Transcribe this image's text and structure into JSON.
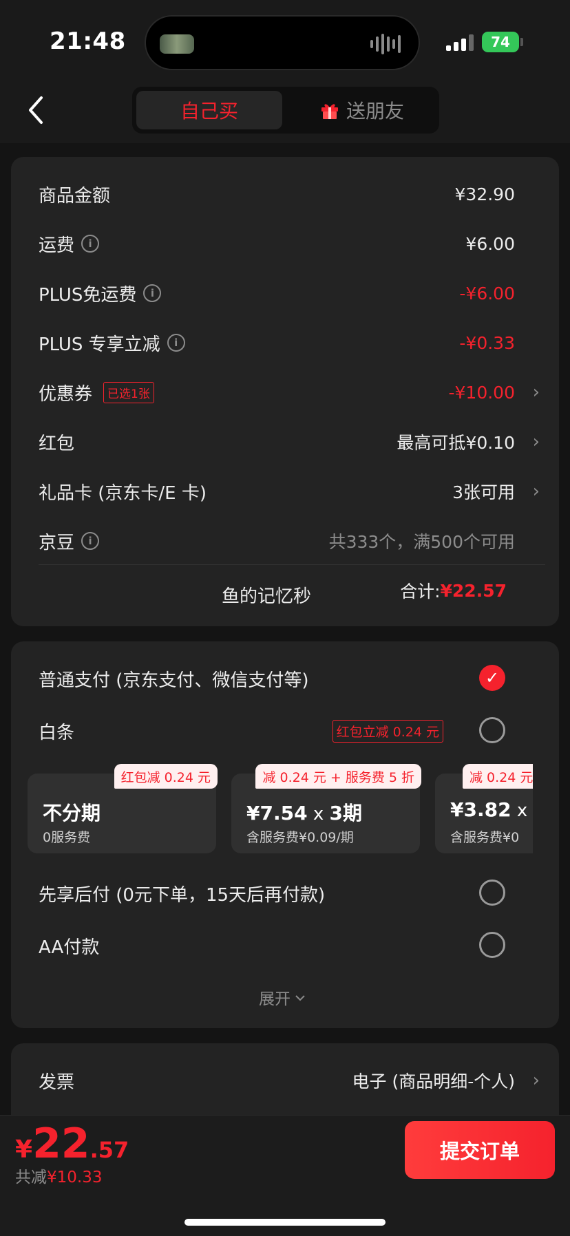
{
  "status": {
    "time": "21:48",
    "battery": "74"
  },
  "nav": {
    "tab_self": "自己买",
    "tab_gift": "送朋友"
  },
  "summary": {
    "goods_label": "商品金额",
    "goods_value": "¥32.90",
    "shipping_label": "运费",
    "shipping_value": "¥6.00",
    "plus_free_label": "PLUS免运费",
    "plus_free_value": "-¥6.00",
    "plus_cut_label": "PLUS 专享立减",
    "plus_cut_value": "-¥0.33",
    "coupon_label": "优惠券",
    "coupon_tag": "已选1张",
    "coupon_value": "-¥10.00",
    "redpack_label": "红包",
    "redpack_value": "最高可抵¥0.10",
    "giftcard_label": "礼品卡 (京东卡/E 卡)",
    "giftcard_value": "3张可用",
    "beans_label": "京豆",
    "beans_value": "共333个，满500个可用",
    "shop_name": "鱼的记忆秒",
    "total_label": "合计:",
    "total_value": "¥22.57"
  },
  "payment": {
    "normal_label": "普通支付 (京东支付、微信支付等)",
    "baitiao_label": "白条",
    "baitiao_tag": "红包立减 0.24 元",
    "plans": [
      {
        "badge": "红包减 0.24 元",
        "main": "不分期",
        "x": "",
        "periods": "",
        "sub": "0服务费"
      },
      {
        "badge": "减 0.24 元 + 服务费 5 折",
        "main": "¥7.54",
        "x": " x ",
        "periods": "3期",
        "sub": "含服务费¥0.09/期"
      },
      {
        "badge": "减 0.24 元",
        "main": "¥3.82",
        "x": " x ",
        "periods": "",
        "sub": "含服务费¥0"
      }
    ],
    "later_label": "先享后付 (0元下单，15天后再付款)",
    "aa_label": "AA付款",
    "expand_label": "展开"
  },
  "invoice": {
    "label": "发票",
    "value": "电子 (商品明细-个人)"
  },
  "footer": {
    "currency": "¥",
    "price_int": "22",
    "price_dec": ".57",
    "saved_label": "共减",
    "saved_value": "¥10.33",
    "submit_label": "提交订单"
  },
  "colors": {
    "accent": "#f5222d",
    "background": "#141414",
    "card": "#232323"
  }
}
